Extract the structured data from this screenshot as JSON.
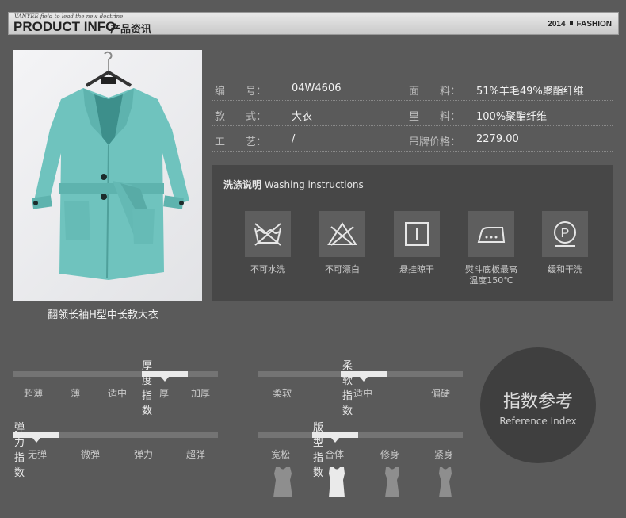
{
  "header": {
    "tagline": "VANYEE field to lead the new doctrine",
    "title_en": "PRODUCT INFO",
    "title_cn": "产品资讯",
    "year": "2014",
    "tag": "FASHION"
  },
  "product": {
    "caption": "翻领长袖H型中长款大衣",
    "image": "teal-wool-coat-on-hanger"
  },
  "info": [
    {
      "l1": "编　　号：",
      "v1": "04W4606",
      "l2": "面　　料：",
      "v2": "51%羊毛49%聚酯纤维"
    },
    {
      "l1": "款　　式：",
      "v1": "大衣",
      "l2": "里　　料：",
      "v2": "100%聚酯纤维"
    },
    {
      "l1": "工　　艺：",
      "v1": "/",
      "l2": "吊牌价格：",
      "v2": "2279.00"
    }
  ],
  "washing": {
    "title_cn": "洗涤说明",
    "title_en": "Washing instructions",
    "items": [
      {
        "label": "不可水洗",
        "icon": "no-wash-icon"
      },
      {
        "label": "不可漂白",
        "icon": "no-bleach-icon"
      },
      {
        "label": "悬挂晾干",
        "icon": "hang-dry-icon"
      },
      {
        "label": "熨斗底板最高\n温度150℃",
        "icon": "iron-150-icon"
      },
      {
        "label": "缓和干洗",
        "icon": "gentle-dry-clean-icon"
      }
    ]
  },
  "indices": {
    "thickness": {
      "title": "厚度指数",
      "options": [
        "超薄",
        "薄",
        "适中",
        "厚",
        "加厚"
      ],
      "selected": 3
    },
    "softness": {
      "title": "柔软指数",
      "options": [
        "柔软",
        "适中",
        "偏硬"
      ],
      "selected": 1
    },
    "elasticity": {
      "title": "弹力指数",
      "options": [
        "无弹",
        "微弹",
        "弹力",
        "超弹"
      ],
      "selected": 0
    },
    "fit": {
      "title": "版型指数",
      "options": [
        "宽松",
        "合体",
        "修身",
        "紧身"
      ],
      "selected": 1
    }
  },
  "reference": {
    "cn": "指数参考",
    "en": "Reference Index"
  },
  "colors": {
    "background": "#5a5a5a",
    "panel": "#474747",
    "highlight": "#eaeaea",
    "coat": "#6fc3be"
  }
}
